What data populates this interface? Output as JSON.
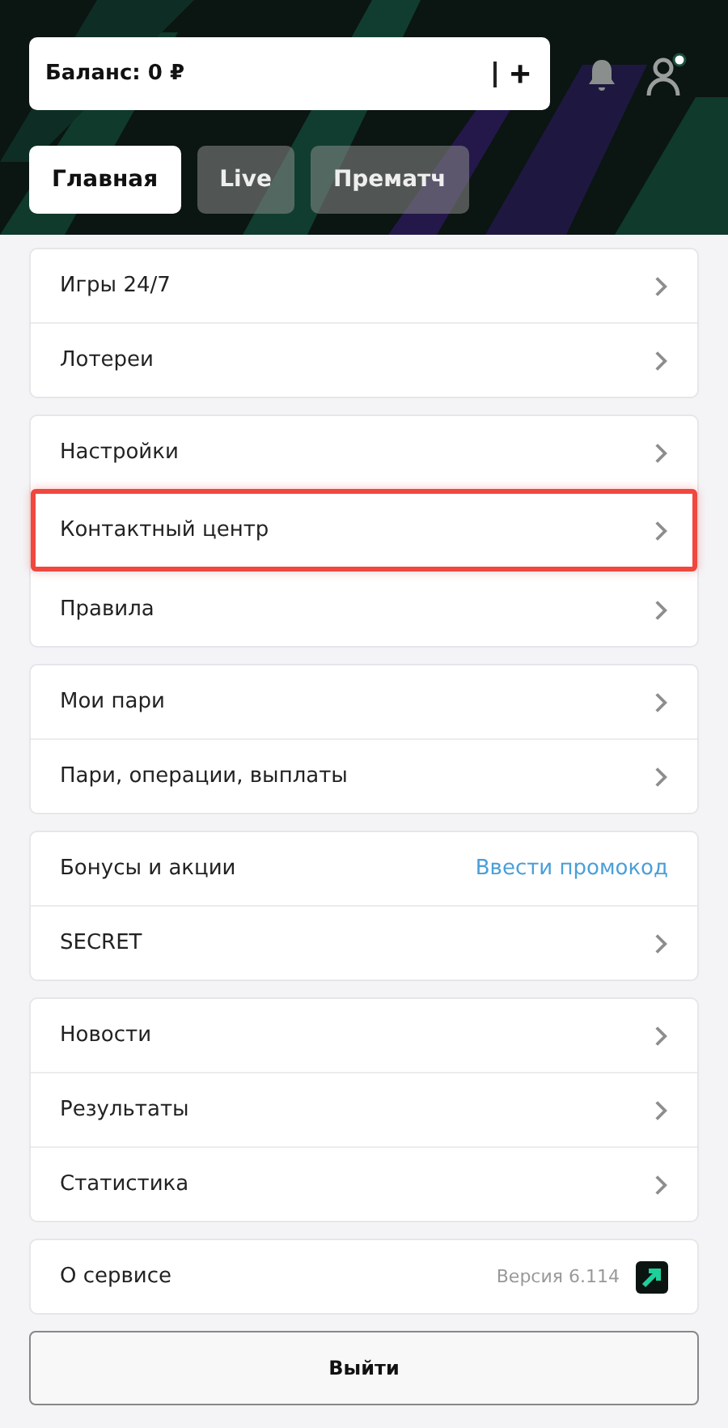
{
  "balance": {
    "label": "Баланс: 0 ₽",
    "add_button": "+"
  },
  "tabs": [
    {
      "label": "Главная",
      "selected": true
    },
    {
      "label": "Live",
      "selected": false
    },
    {
      "label": "Прематч",
      "selected": false
    }
  ],
  "groups": [
    {
      "rows": [
        {
          "kind": "chevron",
          "label": "Игры 24/7",
          "highlighted": false
        },
        {
          "kind": "chevron",
          "label": "Лотереи",
          "highlighted": false
        }
      ]
    },
    {
      "rows": [
        {
          "kind": "chevron",
          "label": "Настройки",
          "highlighted": false
        },
        {
          "kind": "chevron",
          "label": "Контактный центр",
          "highlighted": true
        },
        {
          "kind": "chevron",
          "label": "Правила",
          "highlighted": false
        }
      ]
    },
    {
      "rows": [
        {
          "kind": "chevron",
          "label": "Мои пари",
          "highlighted": false
        },
        {
          "kind": "chevron",
          "label": "Пари, операции, выплаты",
          "highlighted": false
        }
      ]
    },
    {
      "rows": [
        {
          "kind": "link",
          "label": "Бонусы и акции",
          "link": "Ввести промокод",
          "highlighted": false
        },
        {
          "kind": "chevron",
          "label": "SECRET",
          "highlighted": false
        }
      ]
    },
    {
      "rows": [
        {
          "kind": "chevron",
          "label": "Новости",
          "highlighted": false
        },
        {
          "kind": "chevron",
          "label": "Результаты",
          "highlighted": false
        },
        {
          "kind": "chevron",
          "label": "Статистика",
          "highlighted": false
        }
      ]
    },
    {
      "rows": [
        {
          "kind": "version",
          "label": "О сервисе",
          "version": "Версия 6.114",
          "highlighted": false
        }
      ]
    }
  ],
  "logout_button": "Выйти"
}
